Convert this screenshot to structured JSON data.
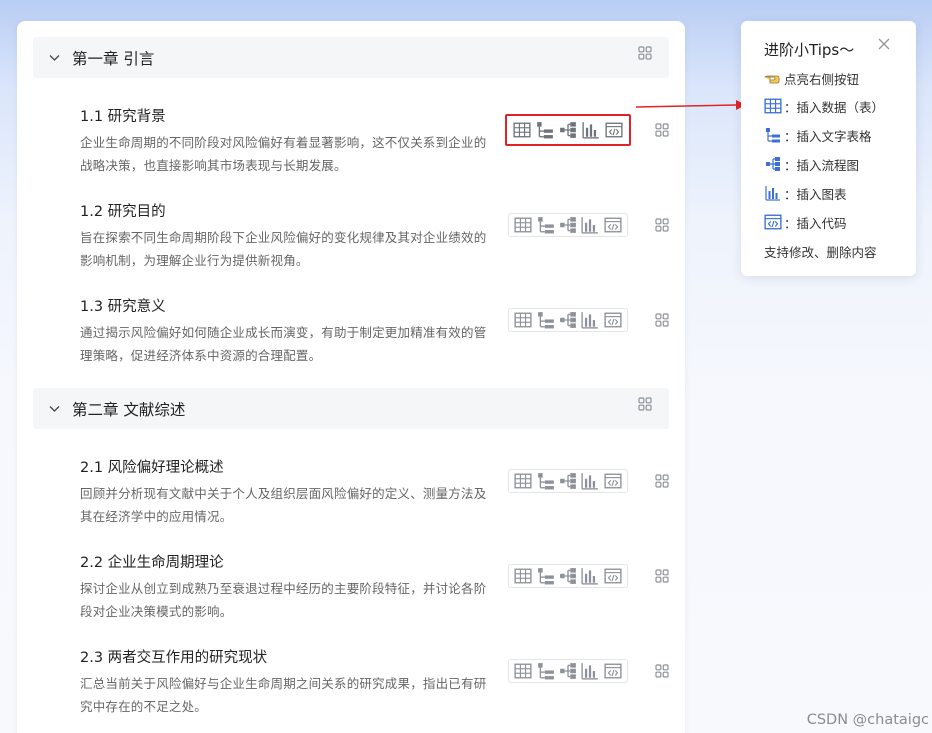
{
  "outline": {
    "chapters": [
      {
        "title": "第一章 引言",
        "sections": [
          {
            "title": "1.1 研究背景",
            "desc": "企业生命周期的不同阶段对风险偏好有着显著影响，这不仅关系到企业的战略决策，也直接影响其市场表现与长期发展。"
          },
          {
            "title": "1.2 研究目的",
            "desc": "旨在探索不同生命周期阶段下企业风险偏好的变化规律及其对企业绩效的影响机制，为理解企业行为提供新视角。"
          },
          {
            "title": "1.3 研究意义",
            "desc": "通过揭示风险偏好如何随企业成长而演变，有助于制定更加精准有效的管理策略，促进经济体系中资源的合理配置。"
          }
        ]
      },
      {
        "title": "第二章 文献综述",
        "sections": [
          {
            "title": "2.1 风险偏好理论概述",
            "desc": "回顾并分析现有文献中关于个人及组织层面风险偏好的定义、测量方法及其在经济学中的应用情况。"
          },
          {
            "title": "2.2 企业生命周期理论",
            "desc": "探讨企业从创立到成熟乃至衰退过程中经历的主要阶段特征，并讨论各阶段对企业决策模式的影响。"
          },
          {
            "title": "2.3 两者交互作用的研究现状",
            "desc": "汇总当前关于风险偏好与企业生命周期之间关系的研究成果，指出已有研究中存在的不足之处。"
          }
        ]
      }
    ],
    "toolbar_icons": [
      "table-icon",
      "text-table-icon",
      "flowchart-icon",
      "bar-chart-icon",
      "code-icon"
    ]
  },
  "tips": {
    "title": "进阶小Tips～",
    "items": [
      {
        "icon": "pointing-hand-icon",
        "label": "点亮右侧按钮"
      },
      {
        "icon": "table-icon",
        "label": "：插入数据（表）"
      },
      {
        "icon": "text-table-icon",
        "label": "：插入文字表格"
      },
      {
        "icon": "flowchart-icon",
        "label": "：插入流程图"
      },
      {
        "icon": "bar-chart-icon",
        "label": "：插入图表"
      },
      {
        "icon": "code-icon",
        "label": "：插入代码"
      }
    ],
    "footer": "支持修改、删除内容"
  },
  "watermark": "CSDN @chataigc",
  "colors": {
    "highlight": "#e02424",
    "icon_blue": "#3a6fd8",
    "icon_gray": "#7a7f88"
  }
}
